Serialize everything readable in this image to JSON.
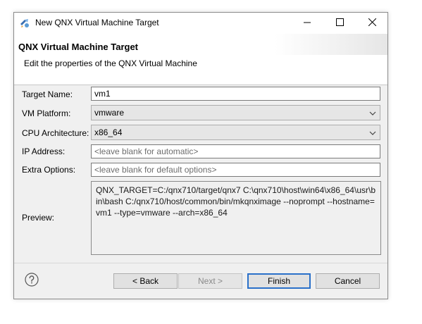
{
  "window": {
    "title": "New QNX Virtual Machine Target",
    "icon": "qnx-target-icon",
    "controls": [
      "minimize-icon",
      "maximize-icon",
      "close-icon"
    ]
  },
  "banner": {
    "title": "QNX Virtual Machine Target",
    "description": "Edit the properties of the QNX Virtual Machine"
  },
  "form": {
    "target_name_label": "Target Name:",
    "target_name_value": "vm1",
    "vm_platform_label": "VM Platform:",
    "vm_platform_value": "vmware",
    "cpu_arch_label": "CPU Architecture:",
    "cpu_arch_value": "x86_64",
    "ip_address_label": "IP Address:",
    "ip_address_placeholder": "<leave blank for automatic>",
    "extra_options_label": "Extra Options:",
    "extra_options_placeholder": "<leave blank for default options>",
    "preview_label": "Preview:",
    "preview_text": "QNX_TARGET=C:/qnx710/target/qnx7 C:\\qnx710\\host\\win64\\x86_64\\usr\\bin\\bash C:/qnx710/host/common/bin/mkqnximage --noprompt --hostname=vm1 --type=vmware --arch=x86_64"
  },
  "buttons": {
    "back": "< Back",
    "next": "Next >",
    "finish": "Finish",
    "cancel": "Cancel"
  },
  "colors": {
    "dialog_bg": "#f0f0f0",
    "default_button_border": "#2a70c9"
  }
}
